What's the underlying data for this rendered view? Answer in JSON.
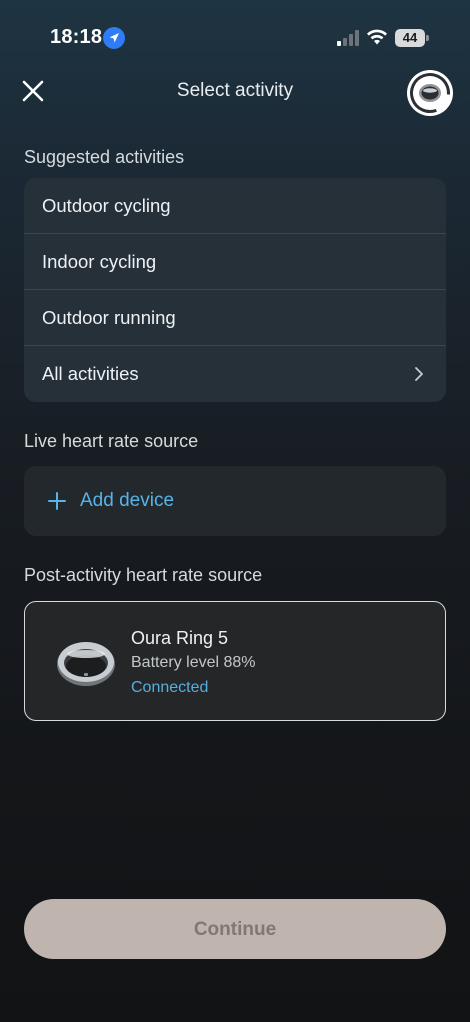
{
  "status_bar": {
    "time": "18:18",
    "battery": "44",
    "icons": [
      "location-arrow-icon",
      "cellular-signal-icon",
      "wifi-icon",
      "battery-icon"
    ]
  },
  "header": {
    "title": "Select activity",
    "close_icon": "close-icon",
    "avatar_icon": "ring-avatar-icon"
  },
  "suggested": {
    "heading": "Suggested activities",
    "items": [
      {
        "label": "Outdoor cycling"
      },
      {
        "label": "Indoor cycling"
      },
      {
        "label": "Outdoor running"
      },
      {
        "label": "All activities",
        "icon": "chevron-right-icon"
      }
    ]
  },
  "live_source": {
    "heading": "Live heart rate source",
    "add_label": "Add device",
    "add_icon": "plus-icon"
  },
  "post_source": {
    "heading": "Post-activity heart rate source",
    "device": {
      "name": "Oura Ring 5",
      "battery": "Battery level 88%",
      "status": "Connected"
    }
  },
  "footer": {
    "continue_label": "Continue"
  },
  "colors": {
    "accent_blue": "#58b3e8",
    "card_bg": "#253039",
    "button_disabled_bg": "#bfb4ae",
    "button_disabled_text": "#807873"
  }
}
